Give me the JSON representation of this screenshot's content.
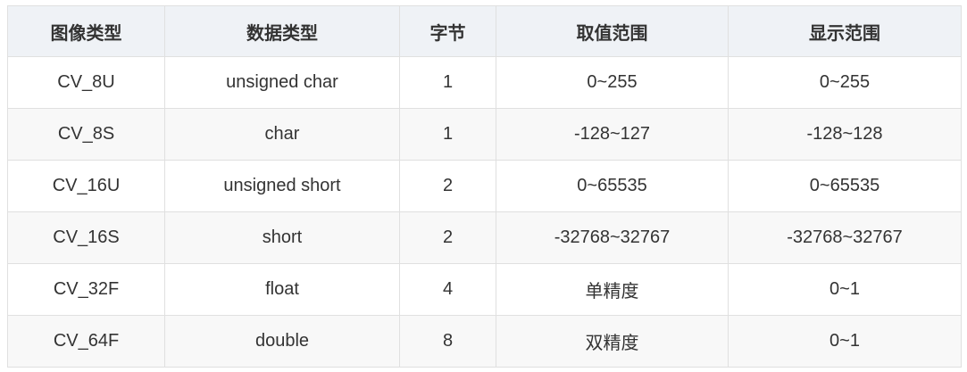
{
  "table": {
    "headers": [
      "图像类型",
      "数据类型",
      "字节",
      "取值范围",
      "显示范围"
    ],
    "rows": [
      [
        "CV_8U",
        "unsigned char",
        "1",
        "0~255",
        "0~255"
      ],
      [
        "CV_8S",
        "char",
        "1",
        "-128~127",
        "-128~128"
      ],
      [
        "CV_16U",
        "unsigned short",
        "2",
        "0~65535",
        "0~65535"
      ],
      [
        "CV_16S",
        "short",
        "2",
        "-32768~32767",
        "-32768~32767"
      ],
      [
        "CV_32F",
        "float",
        "4",
        "单精度",
        "0~1"
      ],
      [
        "CV_64F",
        "double",
        "8",
        "双精度",
        "0~1"
      ]
    ]
  }
}
